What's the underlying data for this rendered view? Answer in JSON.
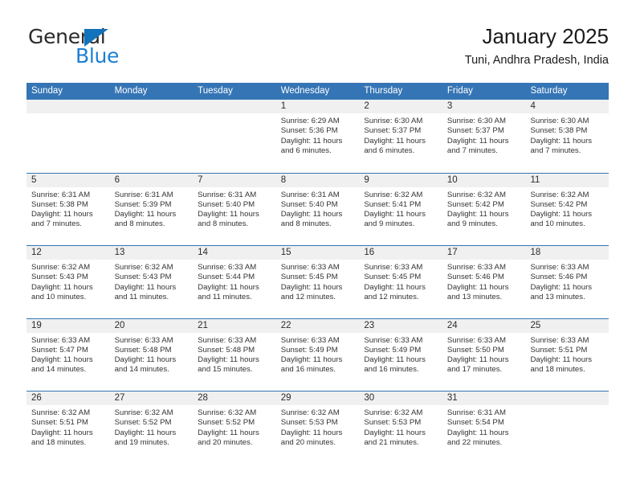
{
  "logo": {
    "word_top": "General",
    "word_bottom": "Blue",
    "triangle_color": "#1272bb",
    "blue_color": "#1b7fd4"
  },
  "header": {
    "title": "January 2025",
    "subtitle": "Tuni, Andhra Pradesh, India"
  },
  "theme": {
    "header_blue": "#3575b5",
    "date_strip_gray": "#f0f0f0",
    "text_color": "#333333"
  },
  "calendar": {
    "day_headers": [
      "Sunday",
      "Monday",
      "Tuesday",
      "Wednesday",
      "Thursday",
      "Friday",
      "Saturday"
    ],
    "weeks": [
      [
        {
          "day": "",
          "blank": true
        },
        {
          "day": "",
          "blank": true
        },
        {
          "day": "",
          "blank": true
        },
        {
          "day": "1",
          "sunrise": "Sunrise: 6:29 AM",
          "sunset": "Sunset: 5:36 PM",
          "daylight": "Daylight: 11 hours and 6 minutes."
        },
        {
          "day": "2",
          "sunrise": "Sunrise: 6:30 AM",
          "sunset": "Sunset: 5:37 PM",
          "daylight": "Daylight: 11 hours and 6 minutes."
        },
        {
          "day": "3",
          "sunrise": "Sunrise: 6:30 AM",
          "sunset": "Sunset: 5:37 PM",
          "daylight": "Daylight: 11 hours and 7 minutes."
        },
        {
          "day": "4",
          "sunrise": "Sunrise: 6:30 AM",
          "sunset": "Sunset: 5:38 PM",
          "daylight": "Daylight: 11 hours and 7 minutes."
        }
      ],
      [
        {
          "day": "5",
          "sunrise": "Sunrise: 6:31 AM",
          "sunset": "Sunset: 5:38 PM",
          "daylight": "Daylight: 11 hours and 7 minutes."
        },
        {
          "day": "6",
          "sunrise": "Sunrise: 6:31 AM",
          "sunset": "Sunset: 5:39 PM",
          "daylight": "Daylight: 11 hours and 8 minutes."
        },
        {
          "day": "7",
          "sunrise": "Sunrise: 6:31 AM",
          "sunset": "Sunset: 5:40 PM",
          "daylight": "Daylight: 11 hours and 8 minutes."
        },
        {
          "day": "8",
          "sunrise": "Sunrise: 6:31 AM",
          "sunset": "Sunset: 5:40 PM",
          "daylight": "Daylight: 11 hours and 8 minutes."
        },
        {
          "day": "9",
          "sunrise": "Sunrise: 6:32 AM",
          "sunset": "Sunset: 5:41 PM",
          "daylight": "Daylight: 11 hours and 9 minutes."
        },
        {
          "day": "10",
          "sunrise": "Sunrise: 6:32 AM",
          "sunset": "Sunset: 5:42 PM",
          "daylight": "Daylight: 11 hours and 9 minutes."
        },
        {
          "day": "11",
          "sunrise": "Sunrise: 6:32 AM",
          "sunset": "Sunset: 5:42 PM",
          "daylight": "Daylight: 11 hours and 10 minutes."
        }
      ],
      [
        {
          "day": "12",
          "sunrise": "Sunrise: 6:32 AM",
          "sunset": "Sunset: 5:43 PM",
          "daylight": "Daylight: 11 hours and 10 minutes."
        },
        {
          "day": "13",
          "sunrise": "Sunrise: 6:32 AM",
          "sunset": "Sunset: 5:43 PM",
          "daylight": "Daylight: 11 hours and 11 minutes."
        },
        {
          "day": "14",
          "sunrise": "Sunrise: 6:33 AM",
          "sunset": "Sunset: 5:44 PM",
          "daylight": "Daylight: 11 hours and 11 minutes."
        },
        {
          "day": "15",
          "sunrise": "Sunrise: 6:33 AM",
          "sunset": "Sunset: 5:45 PM",
          "daylight": "Daylight: 11 hours and 12 minutes."
        },
        {
          "day": "16",
          "sunrise": "Sunrise: 6:33 AM",
          "sunset": "Sunset: 5:45 PM",
          "daylight": "Daylight: 11 hours and 12 minutes."
        },
        {
          "day": "17",
          "sunrise": "Sunrise: 6:33 AM",
          "sunset": "Sunset: 5:46 PM",
          "daylight": "Daylight: 11 hours and 13 minutes."
        },
        {
          "day": "18",
          "sunrise": "Sunrise: 6:33 AM",
          "sunset": "Sunset: 5:46 PM",
          "daylight": "Daylight: 11 hours and 13 minutes."
        }
      ],
      [
        {
          "day": "19",
          "sunrise": "Sunrise: 6:33 AM",
          "sunset": "Sunset: 5:47 PM",
          "daylight": "Daylight: 11 hours and 14 minutes."
        },
        {
          "day": "20",
          "sunrise": "Sunrise: 6:33 AM",
          "sunset": "Sunset: 5:48 PM",
          "daylight": "Daylight: 11 hours and 14 minutes."
        },
        {
          "day": "21",
          "sunrise": "Sunrise: 6:33 AM",
          "sunset": "Sunset: 5:48 PM",
          "daylight": "Daylight: 11 hours and 15 minutes."
        },
        {
          "day": "22",
          "sunrise": "Sunrise: 6:33 AM",
          "sunset": "Sunset: 5:49 PM",
          "daylight": "Daylight: 11 hours and 16 minutes."
        },
        {
          "day": "23",
          "sunrise": "Sunrise: 6:33 AM",
          "sunset": "Sunset: 5:49 PM",
          "daylight": "Daylight: 11 hours and 16 minutes."
        },
        {
          "day": "24",
          "sunrise": "Sunrise: 6:33 AM",
          "sunset": "Sunset: 5:50 PM",
          "daylight": "Daylight: 11 hours and 17 minutes."
        },
        {
          "day": "25",
          "sunrise": "Sunrise: 6:33 AM",
          "sunset": "Sunset: 5:51 PM",
          "daylight": "Daylight: 11 hours and 18 minutes."
        }
      ],
      [
        {
          "day": "26",
          "sunrise": "Sunrise: 6:32 AM",
          "sunset": "Sunset: 5:51 PM",
          "daylight": "Daylight: 11 hours and 18 minutes."
        },
        {
          "day": "27",
          "sunrise": "Sunrise: 6:32 AM",
          "sunset": "Sunset: 5:52 PM",
          "daylight": "Daylight: 11 hours and 19 minutes."
        },
        {
          "day": "28",
          "sunrise": "Sunrise: 6:32 AM",
          "sunset": "Sunset: 5:52 PM",
          "daylight": "Daylight: 11 hours and 20 minutes."
        },
        {
          "day": "29",
          "sunrise": "Sunrise: 6:32 AM",
          "sunset": "Sunset: 5:53 PM",
          "daylight": "Daylight: 11 hours and 20 minutes."
        },
        {
          "day": "30",
          "sunrise": "Sunrise: 6:32 AM",
          "sunset": "Sunset: 5:53 PM",
          "daylight": "Daylight: 11 hours and 21 minutes."
        },
        {
          "day": "31",
          "sunrise": "Sunrise: 6:31 AM",
          "sunset": "Sunset: 5:54 PM",
          "daylight": "Daylight: 11 hours and 22 minutes."
        },
        {
          "day": "",
          "blank": true
        }
      ]
    ]
  }
}
